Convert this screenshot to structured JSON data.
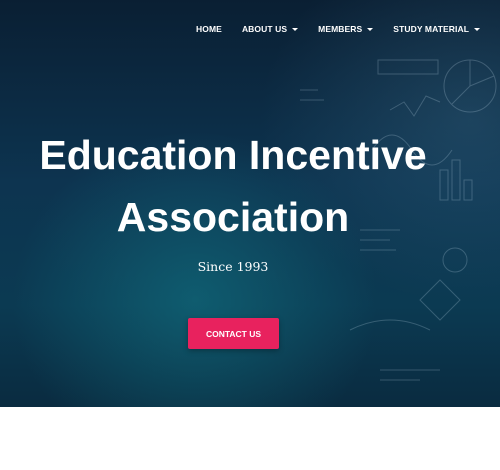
{
  "nav": {
    "items": [
      {
        "label": "HOME",
        "dropdown": false
      },
      {
        "label": "ABOUT US",
        "dropdown": true
      },
      {
        "label": "MEMBERS",
        "dropdown": true
      },
      {
        "label": "STUDY MATERIAL",
        "dropdown": true
      }
    ]
  },
  "hero": {
    "title_line1": "Education Incentive",
    "title_line2": "Association",
    "subtitle": "Since 1993",
    "cta_label": "CONTACT US"
  },
  "colors": {
    "hero_dark": "#0a1f33",
    "hero_teal": "#0d3450",
    "cta": "#e8225e"
  }
}
